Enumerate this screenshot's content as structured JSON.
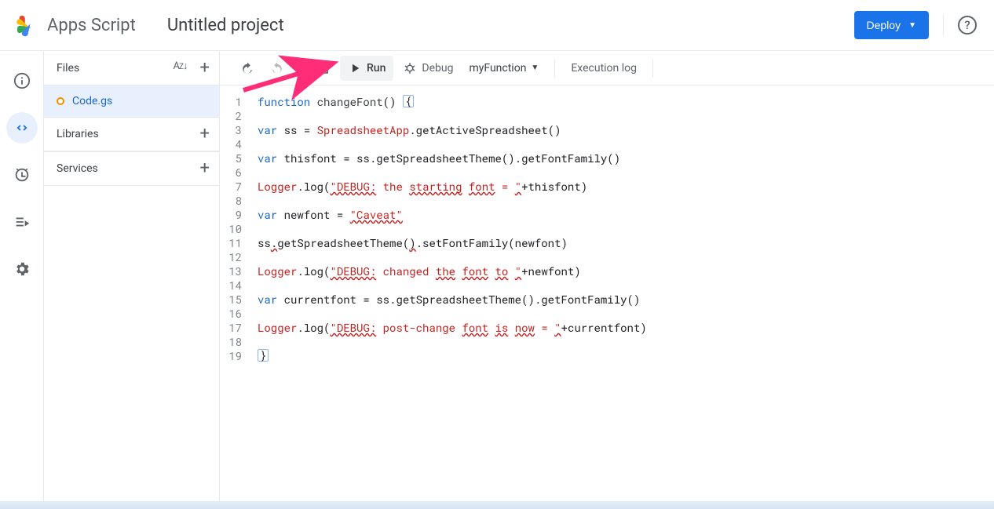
{
  "header": {
    "product": "Apps Script",
    "project_title": "Untitled project",
    "deploy_label": "Deploy"
  },
  "files_panel": {
    "files_label": "Files",
    "file_name": "Code.gs",
    "libraries_label": "Libraries",
    "services_label": "Services"
  },
  "toolbar": {
    "run_label": "Run",
    "debug_label": "Debug",
    "function_name": "myFunction",
    "execution_log_label": "Execution log"
  },
  "editor": {
    "highlighted_line_index": 11,
    "lines": [
      {
        "n": 1,
        "tokens": [
          {
            "t": "function",
            "c": "kw"
          },
          {
            "t": " "
          },
          {
            "t": "changeFont",
            "c": "fn"
          },
          {
            "t": "() "
          },
          {
            "t": "{",
            "c": "caret"
          }
        ]
      },
      {
        "n": 2,
        "tokens": []
      },
      {
        "n": 3,
        "tokens": [
          {
            "t": "var",
            "c": "kw"
          },
          {
            "t": " ss = "
          },
          {
            "t": "SpreadsheetApp",
            "c": "cls"
          },
          {
            "t": ".getActiveSpreadsheet()"
          }
        ]
      },
      {
        "n": 4,
        "tokens": []
      },
      {
        "n": 5,
        "tokens": [
          {
            "t": "var",
            "c": "kw"
          },
          {
            "t": " thisfont = ss.getSpreadsheetTheme().getFontFamily()"
          }
        ]
      },
      {
        "n": 6,
        "tokens": []
      },
      {
        "n": 7,
        "tokens": [
          {
            "t": "Logger",
            "c": "cls"
          },
          {
            "t": ".log("
          },
          {
            "t": "\"DEBUG:",
            "c": "str squig"
          },
          {
            "t": " the ",
            "c": "str"
          },
          {
            "t": "starting",
            "c": "str squig"
          },
          {
            "t": " ",
            "c": "str"
          },
          {
            "t": "font",
            "c": "str squig"
          },
          {
            "t": " = ",
            "c": "str"
          },
          {
            "t": "\"",
            "c": "str squig"
          },
          {
            "t": "+thisfont)"
          }
        ]
      },
      {
        "n": 8,
        "tokens": []
      },
      {
        "n": 9,
        "tokens": [
          {
            "t": "var",
            "c": "kw"
          },
          {
            "t": " newfont = "
          },
          {
            "t": "\"Caveat\"",
            "c": "str squig"
          }
        ]
      },
      {
        "n": 10,
        "tokens": []
      },
      {
        "n": 11,
        "tokens": [
          {
            "t": "ss"
          },
          {
            "t": ".",
            "c": "squig"
          },
          {
            "t": "getSpreadsheetTheme("
          },
          {
            "t": ")",
            "c": "squig"
          },
          {
            "t": ".setFontFamily(newfont)"
          }
        ]
      },
      {
        "n": 12,
        "tokens": []
      },
      {
        "n": 13,
        "tokens": [
          {
            "t": "Logger",
            "c": "cls"
          },
          {
            "t": ".log("
          },
          {
            "t": "\"DEBUG:",
            "c": "str squig"
          },
          {
            "t": " changed ",
            "c": "str"
          },
          {
            "t": "the",
            "c": "str squig"
          },
          {
            "t": " ",
            "c": "str"
          },
          {
            "t": "font",
            "c": "str squig"
          },
          {
            "t": " ",
            "c": "str"
          },
          {
            "t": "to",
            "c": "str squig"
          },
          {
            "t": " ",
            "c": "str"
          },
          {
            "t": "\"",
            "c": "str squig"
          },
          {
            "t": "+newfont)"
          }
        ]
      },
      {
        "n": 14,
        "tokens": []
      },
      {
        "n": 15,
        "tokens": [
          {
            "t": "var",
            "c": "kw"
          },
          {
            "t": " currentfont = ss.getSpreadsheetTheme().getFontFamily()"
          }
        ]
      },
      {
        "n": 16,
        "tokens": []
      },
      {
        "n": 17,
        "tokens": [
          {
            "t": "Logger",
            "c": "cls"
          },
          {
            "t": ".log("
          },
          {
            "t": "\"DEBUG:",
            "c": "str squig"
          },
          {
            "t": " post-change ",
            "c": "str"
          },
          {
            "t": "font",
            "c": "str squig"
          },
          {
            "t": " ",
            "c": "str"
          },
          {
            "t": "is",
            "c": "str squig"
          },
          {
            "t": " ",
            "c": "str"
          },
          {
            "t": "now",
            "c": "str squig"
          },
          {
            "t": " = ",
            "c": "str"
          },
          {
            "t": "\"",
            "c": "str squig"
          },
          {
            "t": "+currentfont)"
          }
        ]
      },
      {
        "n": 18,
        "tokens": []
      },
      {
        "n": 19,
        "tokens": [
          {
            "t": "}",
            "c": "caret"
          }
        ]
      }
    ]
  }
}
